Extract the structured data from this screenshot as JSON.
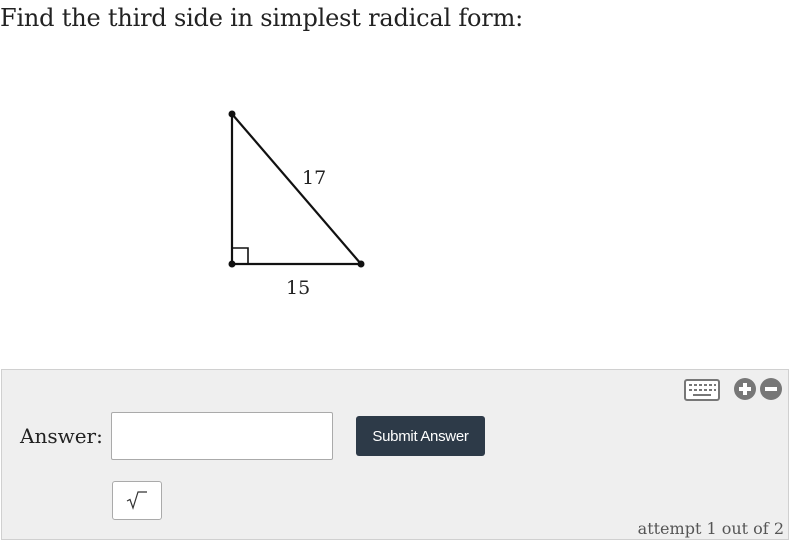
{
  "question": {
    "text": "Find the third side in simplest radical form:"
  },
  "figure": {
    "hypotenuse_label": "17",
    "base_label": "15",
    "right_angle_marker": true
  },
  "answer": {
    "label": "Answer:",
    "input_value": "",
    "input_placeholder": "",
    "submit_label": "Submit Answer",
    "sqrt_button_icon": "square-root-icon",
    "toolbar_icons": [
      "keyboard-icon",
      "zoom-in-icon",
      "zoom-out-icon"
    ],
    "attempt_text": "attempt 1 out of 2"
  },
  "colors": {
    "submit_button": "#2d3a48",
    "panel_background": "#efefef",
    "icon_gray": "#777777"
  }
}
